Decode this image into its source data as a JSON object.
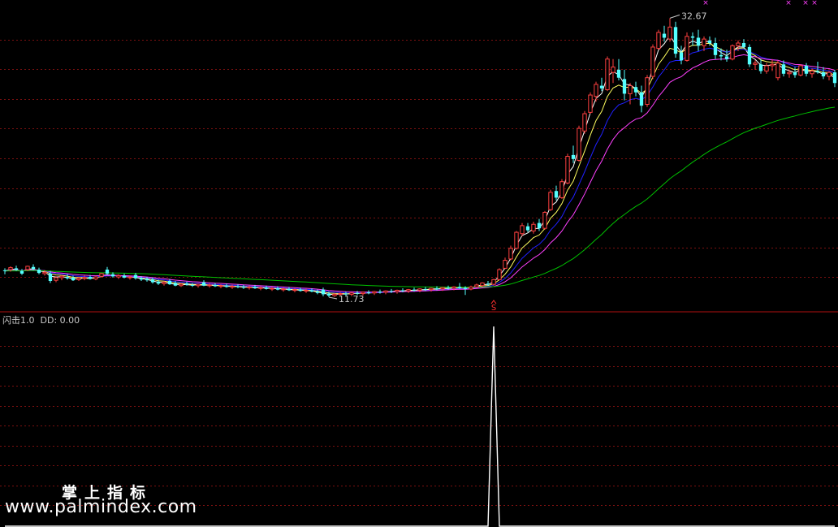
{
  "indicator": {
    "name": "闪击1.0",
    "dd_label": "DD:",
    "dd_value": "0.00"
  },
  "watermark": {
    "title": "掌上指标",
    "url": "www.palmindex.com"
  },
  "colors": {
    "background": "#000000",
    "grid": "#7a1010",
    "separator": "#b01010",
    "candle_up": "#ff4040",
    "candle_down": "#54ffff",
    "ma": [
      "#ffffff",
      "#ffff60",
      "#2020ff",
      "#ff40ff",
      "#00c000"
    ],
    "indicator_line": "#ffffff",
    "signal": "#ff3030",
    "cross_marker": "#ff40ff"
  },
  "chart_data": [
    {
      "type": "candlestick",
      "panel": "price",
      "ylim": [
        11.0,
        33.3
      ],
      "high_label": "32.67",
      "low_label": "11.73",
      "signal_marker": "S",
      "signal_index": 86,
      "moving_averages": [
        "MA1",
        "MA2",
        "MA3",
        "MA4",
        "MA5"
      ],
      "ohlc": [
        [
          13.75,
          13.9,
          13.45,
          13.7
        ],
        [
          13.8,
          14.05,
          13.65,
          13.95
        ],
        [
          13.9,
          14.1,
          13.7,
          13.8
        ],
        [
          13.7,
          13.85,
          13.4,
          13.5
        ],
        [
          13.8,
          14.1,
          13.7,
          14.05
        ],
        [
          14.0,
          14.2,
          13.75,
          13.85
        ],
        [
          13.8,
          13.95,
          13.45,
          13.55
        ],
        [
          13.5,
          13.75,
          13.35,
          13.6
        ],
        [
          13.5,
          13.7,
          12.8,
          12.95
        ],
        [
          13.0,
          13.3,
          12.85,
          13.2
        ],
        [
          13.2,
          13.4,
          13.0,
          13.3
        ],
        [
          13.25,
          13.45,
          13.05,
          13.15
        ],
        [
          13.2,
          13.35,
          12.95,
          13.0
        ],
        [
          13.05,
          13.25,
          12.95,
          13.15
        ],
        [
          13.15,
          13.35,
          13.0,
          13.2
        ],
        [
          13.25,
          13.4,
          13.05,
          13.1
        ],
        [
          13.1,
          13.3,
          13.0,
          13.25
        ],
        [
          13.3,
          13.55,
          13.25,
          13.5
        ],
        [
          13.8,
          14.0,
          13.4,
          13.5
        ],
        [
          13.45,
          13.6,
          13.2,
          13.3
        ],
        [
          13.25,
          13.45,
          13.1,
          13.35
        ],
        [
          13.35,
          13.5,
          13.15,
          13.2
        ],
        [
          13.2,
          13.35,
          13.05,
          13.25
        ],
        [
          13.4,
          13.55,
          13.05,
          13.15
        ],
        [
          13.15,
          13.3,
          12.95,
          13.05
        ],
        [
          13.1,
          13.25,
          12.9,
          13.0
        ],
        [
          13.05,
          13.2,
          12.75,
          12.85
        ],
        [
          12.9,
          13.05,
          12.65,
          12.75
        ],
        [
          12.75,
          12.95,
          12.6,
          12.85
        ],
        [
          12.95,
          13.1,
          12.65,
          12.7
        ],
        [
          12.8,
          12.95,
          12.55,
          12.6
        ],
        [
          12.6,
          12.8,
          12.5,
          12.7
        ],
        [
          12.75,
          12.9,
          12.6,
          12.65
        ],
        [
          12.65,
          12.8,
          12.5,
          12.6
        ],
        [
          12.6,
          12.75,
          12.45,
          12.7
        ],
        [
          12.85,
          13.0,
          12.55,
          12.6
        ],
        [
          12.6,
          12.75,
          12.45,
          12.65
        ],
        [
          12.65,
          12.8,
          12.5,
          12.55
        ],
        [
          12.55,
          12.7,
          12.4,
          12.6
        ],
        [
          12.6,
          12.75,
          12.45,
          12.5
        ],
        [
          12.5,
          12.65,
          12.35,
          12.55
        ],
        [
          12.55,
          12.7,
          12.4,
          12.5
        ],
        [
          12.5,
          12.65,
          12.35,
          12.45
        ],
        [
          12.45,
          12.6,
          12.3,
          12.5
        ],
        [
          12.5,
          12.65,
          12.35,
          12.4
        ],
        [
          12.4,
          12.55,
          12.25,
          12.45
        ],
        [
          12.45,
          12.6,
          12.3,
          12.35
        ],
        [
          12.35,
          12.5,
          12.2,
          12.4
        ],
        [
          12.4,
          12.55,
          12.25,
          12.3
        ],
        [
          12.3,
          12.45,
          12.15,
          12.35
        ],
        [
          12.35,
          12.5,
          12.2,
          12.25
        ],
        [
          12.25,
          12.4,
          12.1,
          12.3
        ],
        [
          12.3,
          12.45,
          12.15,
          12.2
        ],
        [
          12.2,
          12.35,
          12.05,
          12.25
        ],
        [
          12.25,
          12.4,
          12.1,
          12.15
        ],
        [
          12.15,
          12.3,
          11.95,
          12.05
        ],
        [
          12.3,
          12.45,
          11.8,
          11.95
        ],
        [
          12.0,
          12.15,
          11.73,
          11.85
        ],
        [
          11.85,
          12.05,
          11.75,
          11.95
        ],
        [
          11.95,
          12.1,
          11.8,
          12.0
        ],
        [
          12.0,
          12.15,
          11.85,
          11.95
        ],
        [
          11.95,
          12.1,
          11.8,
          12.05
        ],
        [
          12.05,
          12.2,
          11.9,
          12.0
        ],
        [
          12.0,
          12.15,
          11.85,
          12.1
        ],
        [
          12.1,
          12.25,
          11.95,
          12.05
        ],
        [
          12.05,
          12.2,
          11.9,
          12.15
        ],
        [
          12.15,
          12.3,
          12.0,
          12.1
        ],
        [
          12.1,
          12.25,
          11.95,
          12.2
        ],
        [
          12.2,
          12.35,
          12.05,
          12.15
        ],
        [
          12.15,
          12.3,
          12.0,
          12.25
        ],
        [
          12.25,
          12.4,
          12.1,
          12.2
        ],
        [
          12.2,
          12.35,
          12.05,
          12.3
        ],
        [
          12.3,
          12.45,
          12.15,
          12.25
        ],
        [
          12.25,
          12.4,
          12.1,
          12.35
        ],
        [
          12.35,
          12.5,
          12.2,
          12.3
        ],
        [
          12.3,
          12.45,
          12.15,
          12.4
        ],
        [
          12.4,
          12.55,
          12.25,
          12.35
        ],
        [
          12.35,
          12.5,
          12.2,
          12.45
        ],
        [
          12.45,
          12.6,
          12.3,
          12.4
        ],
        [
          12.4,
          12.55,
          12.25,
          12.5
        ],
        [
          12.5,
          12.8,
          12.35,
          12.4
        ],
        [
          12.45,
          12.55,
          11.9,
          12.35
        ],
        [
          12.35,
          12.6,
          12.25,
          12.5
        ],
        [
          12.5,
          12.75,
          12.4,
          12.65
        ],
        [
          12.6,
          12.85,
          12.5,
          12.8
        ],
        [
          12.75,
          12.95,
          12.6,
          12.7
        ],
        [
          12.7,
          13.1,
          12.6,
          13.05
        ],
        [
          13.05,
          13.9,
          13.0,
          13.8
        ],
        [
          13.9,
          14.7,
          13.85,
          14.5
        ],
        [
          14.6,
          15.6,
          14.5,
          15.4
        ],
        [
          15.4,
          16.7,
          15.3,
          16.6
        ],
        [
          16.5,
          17.3,
          16.3,
          17.1
        ],
        [
          17.05,
          17.3,
          16.6,
          16.75
        ],
        [
          16.7,
          17.4,
          16.5,
          17.2
        ],
        [
          17.3,
          17.6,
          16.7,
          16.9
        ],
        [
          16.9,
          18.2,
          16.8,
          18.1
        ],
        [
          18.3,
          19.8,
          18.2,
          19.6
        ],
        [
          19.7,
          20.1,
          19.0,
          19.2
        ],
        [
          19.2,
          20.6,
          19.1,
          20.4
        ],
        [
          20.3,
          22.5,
          20.2,
          22.3
        ],
        [
          22.4,
          23.1,
          21.8,
          22.1
        ],
        [
          22.0,
          24.6,
          21.9,
          24.4
        ],
        [
          24.2,
          25.7,
          24.0,
          25.5
        ],
        [
          25.6,
          27.1,
          25.5,
          26.9
        ],
        [
          26.8,
          27.9,
          26.4,
          27.7
        ],
        [
          27.6,
          28.2,
          27.2,
          27.4
        ],
        [
          27.3,
          29.8,
          27.2,
          29.6
        ],
        [
          28.6,
          29.6,
          27.8,
          29.0
        ],
        [
          28.8,
          29.6,
          28.0,
          28.2
        ],
        [
          28.1,
          28.8,
          26.5,
          27.0
        ],
        [
          27.0,
          27.8,
          26.2,
          27.6
        ],
        [
          27.5,
          27.9,
          26.8,
          27.1
        ],
        [
          27.1,
          27.6,
          25.6,
          26.1
        ],
        [
          26.2,
          28.4,
          26.0,
          28.2
        ],
        [
          28.3,
          30.7,
          28.1,
          30.5
        ],
        [
          30.4,
          31.8,
          30.3,
          31.6
        ],
        [
          31.5,
          32.1,
          30.9,
          31.2
        ],
        [
          31.1,
          32.67,
          30.9,
          32.0
        ],
        [
          32.0,
          32.4,
          29.7,
          30.0
        ],
        [
          30.1,
          30.6,
          29.2,
          29.5
        ],
        [
          29.5,
          31.6,
          29.4,
          31.3
        ],
        [
          31.3,
          31.6,
          30.6,
          31.2
        ],
        [
          31.2,
          31.8,
          30.2,
          30.6
        ],
        [
          30.6,
          31.3,
          30.2,
          31.1
        ],
        [
          31.0,
          31.3,
          30.6,
          30.8
        ],
        [
          30.8,
          31.2,
          29.6,
          29.9
        ],
        [
          29.9,
          30.4,
          29.5,
          29.8
        ],
        [
          29.8,
          30.3,
          29.4,
          29.6
        ],
        [
          29.6,
          30.7,
          29.5,
          30.6
        ],
        [
          30.6,
          31.0,
          30.2,
          30.8
        ],
        [
          30.8,
          31.1,
          30.4,
          30.5
        ],
        [
          30.5,
          30.7,
          29.0,
          29.2
        ],
        [
          29.2,
          29.5,
          28.8,
          29.3
        ],
        [
          29.2,
          29.6,
          28.5,
          28.7
        ],
        [
          28.7,
          29.3,
          28.5,
          29.1
        ],
        [
          29.1,
          29.6,
          28.7,
          29.2
        ],
        [
          28.2,
          29.5,
          28.0,
          29.3
        ],
        [
          29.2,
          29.5,
          28.3,
          28.5
        ],
        [
          28.5,
          28.8,
          28.2,
          28.6
        ],
        [
          28.6,
          29.0,
          28.2,
          28.4
        ],
        [
          28.4,
          29.2,
          28.3,
          29.1
        ],
        [
          29.1,
          29.3,
          28.3,
          28.5
        ],
        [
          28.5,
          28.9,
          28.2,
          28.7
        ],
        [
          28.7,
          29.4,
          28.5,
          28.6
        ],
        [
          28.6,
          29.0,
          28.1,
          28.3
        ],
        [
          28.3,
          28.7,
          28.0,
          28.6
        ],
        [
          28.6,
          28.8,
          27.5,
          27.8
        ]
      ]
    },
    {
      "type": "line",
      "panel": "indicator",
      "name": "DD",
      "ylim": [
        0,
        1
      ],
      "spike_index": 86,
      "spike_value": 1.0
    }
  ]
}
